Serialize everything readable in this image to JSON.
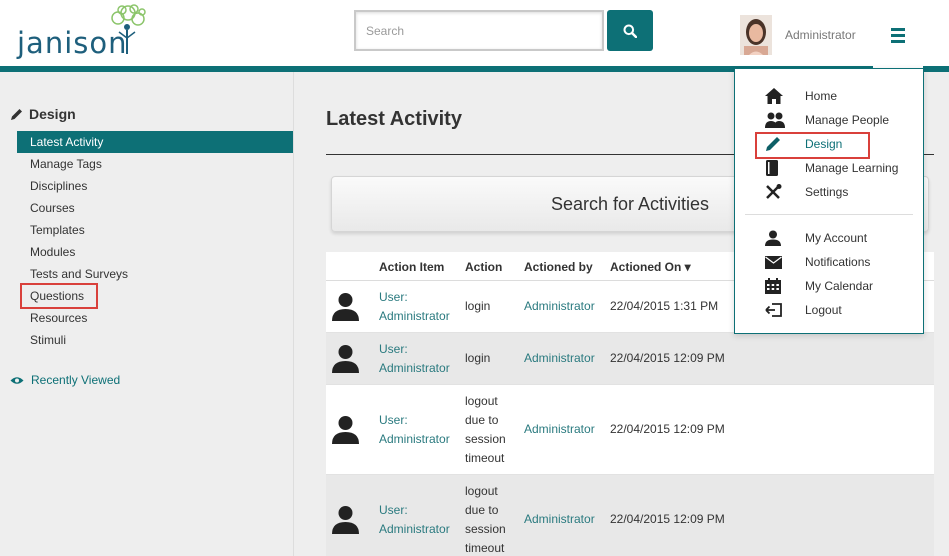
{
  "brand": {
    "logo_text": "janison"
  },
  "search": {
    "placeholder": "Search"
  },
  "user": {
    "name": "Administrator"
  },
  "sidebar": {
    "heading": "Design",
    "items": [
      {
        "label": "Latest Activity",
        "active": true
      },
      {
        "label": "Manage Tags"
      },
      {
        "label": "Disciplines"
      },
      {
        "label": "Courses"
      },
      {
        "label": "Templates"
      },
      {
        "label": "Modules"
      },
      {
        "label": "Tests and Surveys"
      },
      {
        "label": "Questions",
        "highlighted": true
      },
      {
        "label": "Resources"
      },
      {
        "label": "Stimuli"
      }
    ],
    "recently_viewed": "Recently Viewed"
  },
  "main": {
    "title": "Latest Activity",
    "search_activities": "Search for Activities",
    "table": {
      "headers": {
        "action_item": "Action Item",
        "action": "Action",
        "actioned_by": "Actioned by",
        "actioned_on": "Actioned On ▾"
      },
      "rows": [
        {
          "item_1": "User:",
          "item_2": "Administrator",
          "action": [
            "login"
          ],
          "by": "Administrator",
          "on": "22/04/2015 1:31 PM"
        },
        {
          "item_1": "User:",
          "item_2": "Administrator",
          "action": [
            "login"
          ],
          "by": "Administrator",
          "on": "22/04/2015 12:09 PM"
        },
        {
          "item_1": "User:",
          "item_2": "Administrator",
          "action": [
            "logout",
            "due to",
            "session",
            "timeout"
          ],
          "by": "Administrator",
          "on": "22/04/2015 12:09 PM"
        },
        {
          "item_1": "User:",
          "item_2": "Administrator",
          "action": [
            "logout",
            "due to",
            "session",
            "timeout"
          ],
          "by": "Administrator",
          "on": "22/04/2015 12:09 PM"
        }
      ]
    }
  },
  "dropdown": {
    "items": [
      {
        "label": "Home",
        "icon": "home-icon"
      },
      {
        "label": "Manage People",
        "icon": "people-icon"
      },
      {
        "label": "Design",
        "icon": "pencil-icon",
        "highlighted": true
      },
      {
        "label": "Manage Learning",
        "icon": "book-icon"
      },
      {
        "label": "Settings",
        "icon": "tools-icon"
      },
      {
        "label": "My Account",
        "icon": "user-icon"
      },
      {
        "label": "Notifications",
        "icon": "envelope-icon"
      },
      {
        "label": "My Calendar",
        "icon": "calendar-icon"
      },
      {
        "label": "Logout",
        "icon": "logout-icon"
      }
    ]
  },
  "colors": {
    "brand": "#0d7076",
    "highlight": "#d9403b",
    "link": "#2a7a7f"
  }
}
